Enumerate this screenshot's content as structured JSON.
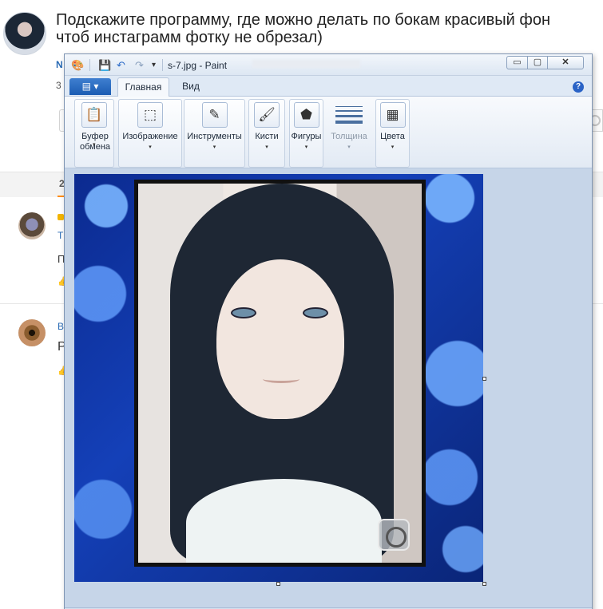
{
  "question": {
    "title_line1": "Подскажите программу, где можно делать по бокам красивый фон",
    "title_line2": "чтоб инстаграмм фотку не обрезал)",
    "meta_cut": "N",
    "meta_cut2": "3"
  },
  "answers_tab": {
    "label": "2"
  },
  "comments": [
    {
      "author": "T",
      "text": "П",
      "like": "👍"
    },
    {
      "author": "В",
      "text": "Р",
      "like": "👍"
    }
  ],
  "paint": {
    "window_title": "s-7.jpg - Paint",
    "win_buttons": {
      "minimize": "▭",
      "maximize": "▢",
      "close": "✕"
    },
    "file_menu": "▤ ▾",
    "tabs": [
      {
        "label": "Главная"
      },
      {
        "label": "Вид"
      }
    ],
    "help": "?",
    "groups": {
      "clipboard": {
        "label": "Буфер обмена",
        "icon": "📋",
        "caret": "▾"
      },
      "image": {
        "label": "Изображение",
        "icon": "⬚",
        "caret": "▾"
      },
      "tools": {
        "label": "Инструменты",
        "icon": "✎",
        "caret": "▾"
      },
      "brushes": {
        "label": "Кисти",
        "icon": "🖌",
        "caret": "▾"
      },
      "shapes": {
        "label": "Фигуры",
        "icon": "⬟",
        "caret": "▾"
      },
      "size": {
        "label": "Толщина",
        "caret": "▾"
      },
      "colors": {
        "label": "Цвета",
        "icon": "▦",
        "caret": "▾"
      }
    },
    "quick_access": {
      "app": "🎨",
      "save": "💾",
      "undo": "↶",
      "redo": "↷",
      "more": "▾"
    }
  },
  "colors": {
    "accent": "#2a6bb5",
    "paint_chrome": "#dfe7f2",
    "canvas_bg": "#c6d5e8"
  }
}
